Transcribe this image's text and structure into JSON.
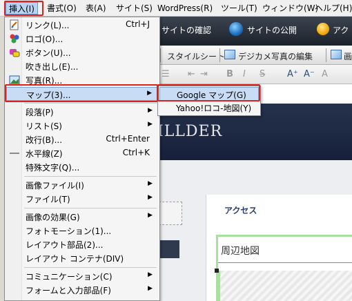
{
  "menubar": {
    "items": [
      "挿入(I)",
      "書式(O)",
      "表(A)",
      "サイト(S)",
      "WordPress(R)",
      "ツール(T)",
      "ウィンドウ(W)",
      "ヘルプ(H)"
    ]
  },
  "toolbar_dark": {
    "site_check": "サイトの確認",
    "site_publish": "サイトの公開",
    "account_partial": "アク"
  },
  "toolbar_gray": {
    "stylesheet": "スタイルシート",
    "photo_edit": "デジカメ写真の編集",
    "image_partial": "画像"
  },
  "editor": {
    "banner_title": "ILLDER",
    "access_label": "アクセス",
    "map_area_label": "周辺地図"
  },
  "insert_menu": {
    "items": [
      {
        "label": "リンク(L)...",
        "shortcut": "Ctrl+J",
        "icon": "link-icon"
      },
      {
        "label": "ロゴ(O)...",
        "shortcut": "",
        "icon": "logo-icon"
      },
      {
        "label": "ボタン(U)...",
        "shortcut": "",
        "icon": "button-icon"
      },
      {
        "label": "吹き出し(E)...",
        "shortcut": "",
        "icon": ""
      },
      {
        "label": "写真(R)...",
        "shortcut": "",
        "icon": "photo-icon"
      },
      {
        "label": "マップ(3)...",
        "shortcut": "",
        "icon": "",
        "submenu": true,
        "highlighted": true
      },
      {
        "label": "段落(P)",
        "shortcut": "",
        "icon": "",
        "submenu": true
      },
      {
        "label": "リスト(S)",
        "shortcut": "",
        "icon": "",
        "submenu": true
      },
      {
        "label": "改行(B)...",
        "shortcut": "Ctrl+Enter",
        "icon": ""
      },
      {
        "label": "水平線(Z)",
        "shortcut": "Ctrl+K",
        "icon": "hr-icon"
      },
      {
        "label": "特殊文字(Q)...",
        "shortcut": "",
        "icon": ""
      },
      {
        "label": "画像ファイル(I)",
        "shortcut": "",
        "icon": "",
        "submenu": true
      },
      {
        "label": "ファイル(T)",
        "shortcut": "",
        "icon": "",
        "submenu": true
      },
      {
        "label": "画像の効果(G)",
        "shortcut": "",
        "icon": "",
        "submenu": true
      },
      {
        "label": "フォトモーション(1)...",
        "shortcut": "",
        "icon": ""
      },
      {
        "label": "レイアウト部品(2)...",
        "shortcut": "",
        "icon": ""
      },
      {
        "label": "レイアウト コンテナ(DIV)",
        "shortcut": "",
        "icon": ""
      },
      {
        "label": "コミュニケーション(C)",
        "shortcut": "",
        "icon": "",
        "submenu": true
      },
      {
        "label": "フォームと入力部品(F)",
        "shortcut": "",
        "icon": "",
        "submenu": true
      }
    ]
  },
  "map_submenu": {
    "items": [
      {
        "label": "Google マップ(G)",
        "highlighted": true
      },
      {
        "label": "Yahoo!ロコ-地図(Y)",
        "highlighted": false
      }
    ]
  },
  "colors": {
    "highlight": "#c9dcf5",
    "red_outline": "#e0201c",
    "banner": "#1c2740"
  }
}
